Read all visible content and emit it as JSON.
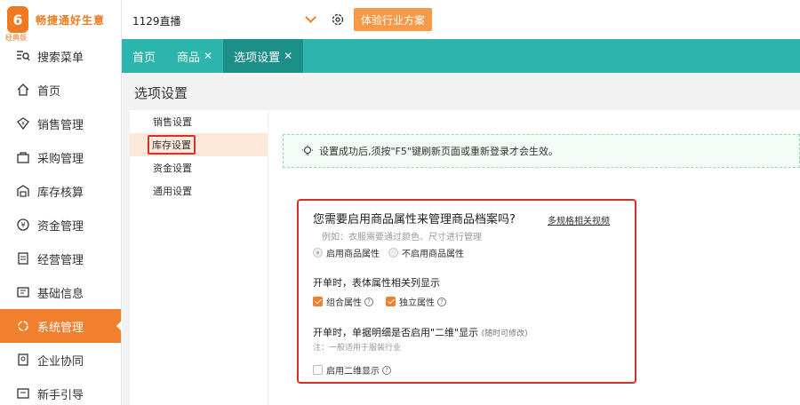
{
  "sidebar": {
    "logo_mark": "6",
    "logo_sub": "经典版",
    "logo_text": "畅捷通好生意",
    "items": [
      {
        "label": "搜索菜单",
        "icon": "search-menu-icon"
      },
      {
        "label": "首页",
        "icon": "home-icon"
      },
      {
        "label": "销售管理",
        "icon": "sales-icon"
      },
      {
        "label": "采购管理",
        "icon": "purchase-icon"
      },
      {
        "label": "库存核算",
        "icon": "inventory-icon"
      },
      {
        "label": "资金管理",
        "icon": "funds-icon"
      },
      {
        "label": "经营管理",
        "icon": "operations-icon"
      },
      {
        "label": "基础信息",
        "icon": "basic-info-icon"
      },
      {
        "label": "系统管理",
        "icon": "system-icon",
        "active": true
      },
      {
        "label": "企业协同",
        "icon": "collaboration-icon"
      },
      {
        "label": "新手引导",
        "icon": "guide-icon"
      }
    ]
  },
  "topbar": {
    "store_name": "1129直播",
    "trial_button": "体验行业方案"
  },
  "tabs": [
    {
      "label": "首页",
      "closable": false
    },
    {
      "label": "商品",
      "closable": true
    },
    {
      "label": "选项设置",
      "closable": true,
      "active": true
    }
  ],
  "page_title": "选项设置",
  "submenu": [
    {
      "label": "销售设置"
    },
    {
      "label": "库存设置",
      "active": true
    },
    {
      "label": "资金设置"
    },
    {
      "label": "通用设置"
    }
  ],
  "tip": "设置成功后,须按\"F5\"键刷新页面或重新登录才会生效。",
  "attribute_section": {
    "question": "您需要启用商品属性来管理商品档案吗?",
    "link": "多规格相关视频",
    "example": "例如：衣服需要通过颜色、尺寸进行管理",
    "option_enable": "启用商品属性",
    "option_disable": "不启用商品属性"
  },
  "columns_section": {
    "title": "开单时，表体属性相关列显示",
    "option_combined": "组合属性",
    "option_independent": "独立属性"
  },
  "matrix_section": {
    "title": "开单时，单据明细是否启用\"二维\"显示",
    "title_note": "(随时可修改)",
    "note": "注：一般适用于服装行业",
    "option": "启用二维显示"
  },
  "colors": {
    "accent": "#f0802e",
    "tabbar": "#2bb5ad",
    "highlight": "#d9302e"
  }
}
